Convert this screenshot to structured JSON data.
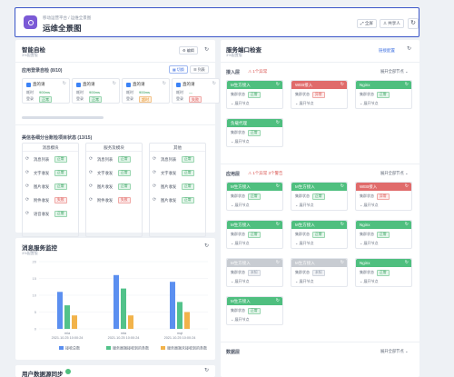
{
  "header": {
    "breadcrumb": "移动运营平台 / 运维全景图",
    "title": "运维全景图",
    "btn_fullscreen": "全屏",
    "btn_share": "共享人"
  },
  "smart_check": {
    "title": "智能自检",
    "subtitle": "3%配置版",
    "edit_label": "编辑",
    "login_check_title": "应用登录自检 (8/10)",
    "view_grid": "切换",
    "view_list": "列表",
    "mini_cards": [
      {
        "name": "直的请",
        "k1": "耗时",
        "v1": "900ms",
        "k2": "登录",
        "v2": "正常",
        "v2_state": "ok"
      },
      {
        "name": "直的请",
        "k1": "耗时",
        "v1": "900ms",
        "k2": "登录",
        "v2": "正常",
        "v2_state": "ok"
      },
      {
        "name": "直的请",
        "k1": "耗时",
        "v1": "900ms",
        "k2": "登录",
        "v2": "超时",
        "v2_state": "warn"
      },
      {
        "name": "直的请",
        "k1": "耗时",
        "v1": "—",
        "k2": "登录",
        "v2": "失败",
        "v2_state": "bad"
      }
    ],
    "item_check_title": "美信各细分台账检项目状态 (13/15)",
    "columns": [
      {
        "title": "消息模块",
        "rows": [
          {
            "name": "消息列表",
            "status": "正常",
            "state": "ok"
          },
          {
            "name": "文字收发",
            "status": "正常",
            "state": "ok"
          },
          {
            "name": "图片收发",
            "status": "正常",
            "state": "ok"
          },
          {
            "name": "附件收发",
            "status": "失败",
            "state": "bad"
          },
          {
            "name": "语音收发",
            "status": "正常",
            "state": "ok"
          }
        ]
      },
      {
        "title": "服务及模块",
        "rows": [
          {
            "name": "消息列表",
            "status": "正常",
            "state": "ok"
          },
          {
            "name": "文字收发",
            "status": "正常",
            "state": "ok"
          },
          {
            "name": "图片收发",
            "status": "正常",
            "state": "ok"
          },
          {
            "name": "附件收发",
            "status": "失败",
            "state": "bad"
          }
        ]
      },
      {
        "title": "其他",
        "rows": [
          {
            "name": "消息列表",
            "status": "正常",
            "state": "ok"
          },
          {
            "name": "文字收发",
            "status": "正常",
            "state": "ok"
          },
          {
            "name": "图片收发",
            "status": "正常",
            "state": "ok"
          },
          {
            "name": "图片收发",
            "status": "正常",
            "state": "ok"
          }
        ]
      }
    ]
  },
  "msg_monitor": {
    "title": "消息服务监控",
    "subtitle": "3%配置版"
  },
  "chart_data": {
    "type": "bar",
    "categories": [
      "mia\n2021.10.25 10:00:24",
      "mta\n2021.10.25 10:00:24",
      "mqt\n2021.10.25 10:00:24"
    ],
    "ylim": [
      0,
      20
    ],
    "yticks": [
      "20",
      "15",
      "10",
      "5",
      "0"
    ],
    "series": [
      {
        "name": "接收总数",
        "color": "#5b8ff0",
        "values": [
          11,
          16,
          14
        ]
      },
      {
        "name": "服务器端接收到的条数",
        "color": "#52c28a",
        "values": [
          7,
          12,
          8
        ]
      },
      {
        "name": "服务器端未接收到的条数",
        "color": "#f2b34a",
        "values": [
          4,
          4,
          5
        ]
      }
    ]
  },
  "user_sync": {
    "title": "用户数据源同步"
  },
  "port_check": {
    "title": "服务端口检查",
    "subtitle": "3%配置版",
    "link_label": "链接配置",
    "layers": [
      {
        "name": "接入层",
        "alert": "1个异常",
        "expand_all": "展开全部节点",
        "cards": [
          {
            "name": "M生方接入",
            "color": "#4fbf7f",
            "status": "正常",
            "state": "ok"
          },
          {
            "name": "WEB接入",
            "color": "#e06b6b",
            "status": "异常",
            "state": "bad"
          },
          {
            "name": "Nginx",
            "color": "#4fbf7f",
            "status": "正常",
            "state": "ok"
          },
          {
            "name": "负载代理",
            "color": "#4fbf7f",
            "status": "正常",
            "state": "ok"
          }
        ]
      },
      {
        "name": "应用层",
        "alert": "1个异常 3个警告",
        "expand_all": "展开全部节点",
        "cards": [
          {
            "name": "M生方接入",
            "color": "#4fbf7f",
            "status": "正常",
            "state": "ok"
          },
          {
            "name": "M生方接入",
            "color": "#4fbf7f",
            "status": "正常",
            "state": "ok"
          },
          {
            "name": "WEB接入",
            "color": "#e06b6b",
            "status": "异常",
            "state": "bad"
          },
          {
            "name": "M生方接入",
            "color": "#4fbf7f",
            "status": "正常",
            "state": "ok"
          },
          {
            "name": "M生方接入",
            "color": "#4fbf7f",
            "status": "正常",
            "state": "ok"
          },
          {
            "name": "Nginx",
            "color": "#4fbf7f",
            "status": "正常",
            "state": "ok"
          },
          {
            "name": "M生方接入",
            "color": "#c8ccd2",
            "status": "未知",
            "state": "na"
          },
          {
            "name": "M生方接入",
            "color": "#c8ccd2",
            "status": "未知",
            "state": "na"
          },
          {
            "name": "Nginx",
            "color": "#4fbf7f",
            "status": "正常",
            "state": "ok"
          },
          {
            "name": "M生方接入",
            "color": "#4fbf7f",
            "status": "正常",
            "state": "ok"
          }
        ]
      },
      {
        "name": "数据层",
        "expand_all": "展开全部节点"
      }
    ],
    "card_status_label": "集群状态",
    "card_expand_label": "展开节点"
  }
}
